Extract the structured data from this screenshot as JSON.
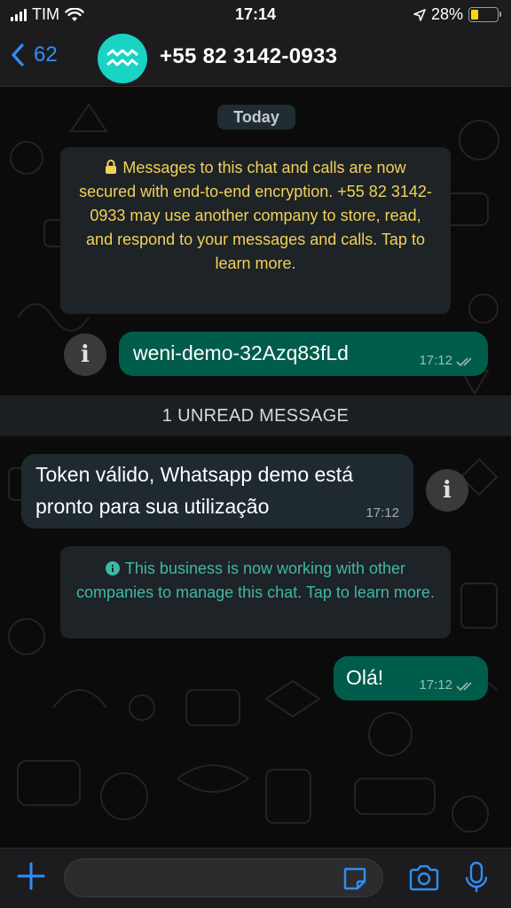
{
  "status_bar": {
    "carrier": "TIM",
    "time": "17:14",
    "battery": "28%",
    "battery_level": 0.28
  },
  "header": {
    "back_count": "62",
    "contact_name": "+55 82 3142-0933"
  },
  "chat": {
    "date_label": "Today",
    "encryption_notice": "Messages to this chat and calls are now secured with end-to-end encryption. +55 82 3142-0933 may use another company to store, read, and respond to your messages and calls. Tap to learn more.",
    "messages": [
      {
        "direction": "outgoing",
        "text": "weni-demo-32Azq83fLd",
        "time": "17:12"
      },
      {
        "direction": "incoming",
        "text_line1": "Token válido, Whatsapp demo está",
        "text_line2": "pronto para sua utilização",
        "time": "17:12"
      },
      {
        "direction": "outgoing",
        "text": "Olá!",
        "time": "17:12"
      }
    ],
    "unread_label": "1 UNREAD MESSAGE",
    "business_notice": "This business is now working with other companies to manage this chat. Tap to learn more."
  },
  "input_bar": {
    "placeholder": ""
  },
  "colors": {
    "accent_blue": "#2f8ef4",
    "outgoing_bubble": "#005c4b",
    "encryption_text": "#f2d15a",
    "business_text": "#3fb8a8",
    "avatar_bg": "#19d3c5"
  }
}
